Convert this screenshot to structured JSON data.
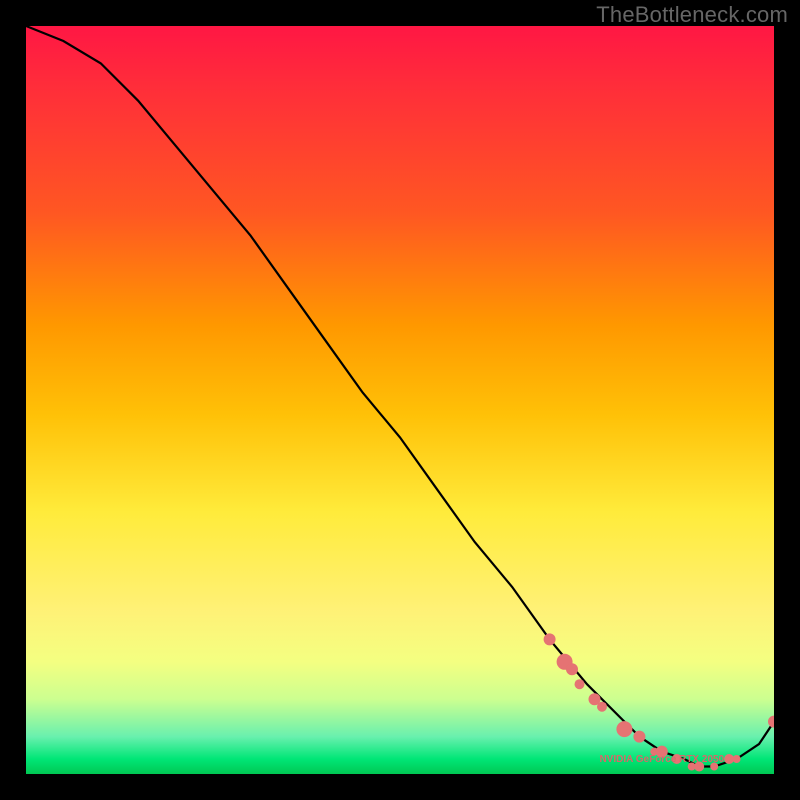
{
  "watermark": "TheBottleneck.com",
  "marker_label": "NVIDIA GeForce RTX 2050",
  "chart_data": {
    "type": "line",
    "title": "",
    "xlabel": "",
    "ylabel": "",
    "xlim": [
      0,
      100
    ],
    "ylim": [
      0,
      100
    ],
    "series": [
      {
        "name": "bottleneck-curve",
        "x": [
          0,
          5,
          10,
          15,
          20,
          25,
          30,
          35,
          40,
          45,
          50,
          55,
          60,
          65,
          70,
          75,
          80,
          82,
          85,
          88,
          90,
          92,
          95,
          98,
          100
        ],
        "values": [
          100,
          98,
          95,
          90,
          84,
          78,
          72,
          65,
          58,
          51,
          45,
          38,
          31,
          25,
          18,
          12,
          7,
          5,
          3,
          2,
          1,
          1,
          2,
          4,
          7
        ]
      }
    ],
    "markers": {
      "name": "highlighted-points",
      "color": "#e57373",
      "points": [
        {
          "x": 70,
          "y": 18,
          "r": 6
        },
        {
          "x": 72,
          "y": 15,
          "r": 8
        },
        {
          "x": 73,
          "y": 14,
          "r": 6
        },
        {
          "x": 74,
          "y": 12,
          "r": 5
        },
        {
          "x": 76,
          "y": 10,
          "r": 6
        },
        {
          "x": 77,
          "y": 9,
          "r": 5
        },
        {
          "x": 80,
          "y": 6,
          "r": 8
        },
        {
          "x": 82,
          "y": 5,
          "r": 6
        },
        {
          "x": 84,
          "y": 3,
          "r": 4
        },
        {
          "x": 85,
          "y": 3,
          "r": 6
        },
        {
          "x": 87,
          "y": 2,
          "r": 5
        },
        {
          "x": 89,
          "y": 1,
          "r": 4
        },
        {
          "x": 90,
          "y": 1,
          "r": 5
        },
        {
          "x": 92,
          "y": 1,
          "r": 4
        },
        {
          "x": 94,
          "y": 2,
          "r": 5
        },
        {
          "x": 95,
          "y": 2,
          "r": 4
        },
        {
          "x": 100,
          "y": 7,
          "r": 6
        }
      ]
    },
    "label_position": {
      "x": 85,
      "y": 2
    }
  }
}
